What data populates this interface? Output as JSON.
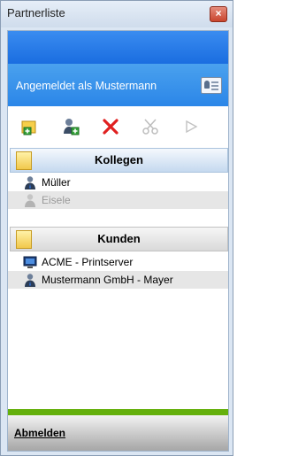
{
  "window": {
    "title": "Partnerliste",
    "close_label": "×"
  },
  "status": {
    "text": "Angemeldet als Mustermann",
    "icon": "id-card-icon"
  },
  "toolbar": [
    {
      "name": "add-contact-list",
      "icon": "add-folder-icon",
      "enabled": true
    },
    {
      "name": "add-contact",
      "icon": "add-user-icon",
      "enabled": true
    },
    {
      "name": "delete",
      "icon": "red-x-icon",
      "enabled": true
    },
    {
      "name": "tools",
      "icon": "scissors-icon",
      "enabled": false
    },
    {
      "name": "connect",
      "icon": "play-icon",
      "enabled": false
    }
  ],
  "groups": [
    {
      "label": "Kollegen",
      "items": [
        {
          "label": "Müller",
          "icon": "user-icon",
          "online": true
        },
        {
          "label": "Eisele",
          "icon": "user-icon",
          "online": false
        }
      ]
    },
    {
      "label": "Kunden",
      "items": [
        {
          "label": "ACME - Printserver",
          "icon": "computer-icon",
          "online": true
        },
        {
          "label": "Mustermann GmbH - Mayer",
          "icon": "user-icon",
          "online": true
        }
      ]
    }
  ],
  "footer": {
    "logout_label": "Abmelden"
  },
  "colors": {
    "accent_blue": "#2b86e8",
    "green": "#64b00c",
    "delete_red": "#e02020"
  }
}
